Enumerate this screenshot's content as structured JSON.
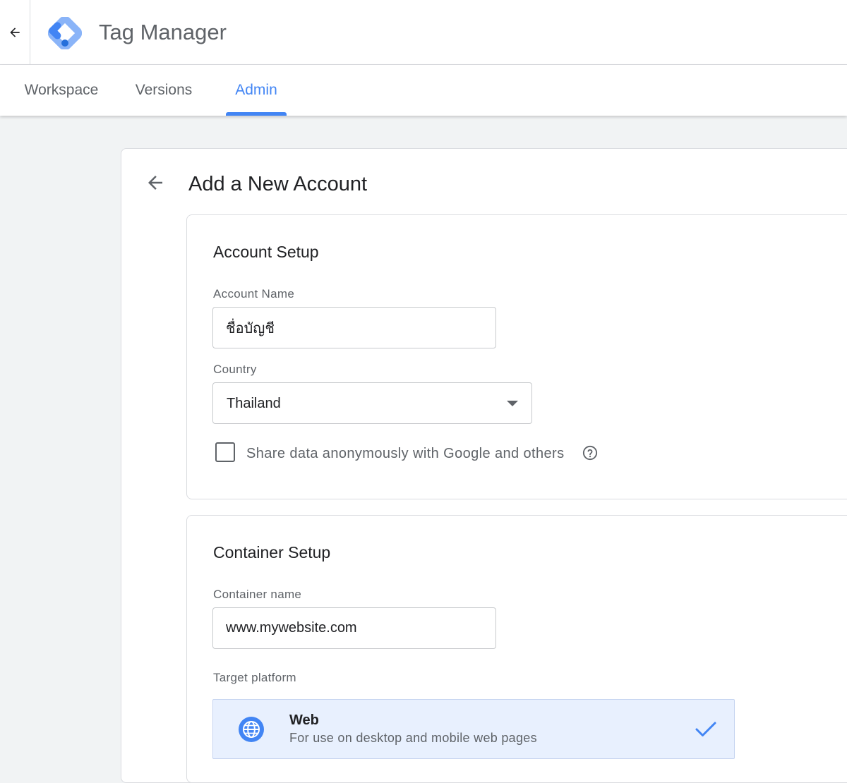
{
  "app": {
    "title": "Tag Manager",
    "brand_color": "#4285f4"
  },
  "tabs": [
    {
      "label": "Workspace",
      "active": false
    },
    {
      "label": "Versions",
      "active": false
    },
    {
      "label": "Admin",
      "active": true
    }
  ],
  "page": {
    "title": "Add a New Account"
  },
  "account_setup": {
    "title": "Account Setup",
    "account_name": {
      "label": "Account Name",
      "value": "ชื่อบัญชี"
    },
    "country": {
      "label": "Country",
      "value": "Thailand"
    },
    "share_data": {
      "label": "Share data anonymously with Google and others",
      "checked": false
    }
  },
  "container_setup": {
    "title": "Container Setup",
    "container_name": {
      "label": "Container name",
      "value": "www.mywebsite.com"
    },
    "target_platform": {
      "label": "Target platform",
      "options": [
        {
          "name": "Web",
          "description": "For use on desktop and mobile web pages",
          "selected": true,
          "icon": "globe-icon"
        }
      ]
    }
  },
  "icons": {
    "back": "arrow-left-icon",
    "logo": "tag-manager-logo",
    "help": "help-circle-icon",
    "selected": "check-icon"
  }
}
